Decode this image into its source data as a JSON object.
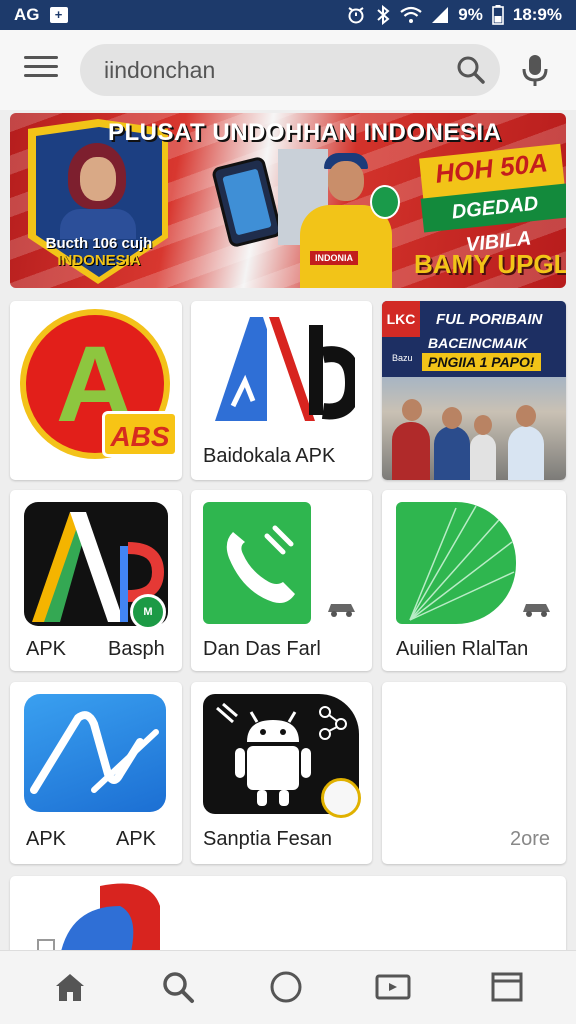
{
  "status_bar": {
    "carrier": "AG",
    "notification_glyph": "+",
    "battery_percent": "9%",
    "time": "18:9%"
  },
  "search": {
    "query": "iindonchan"
  },
  "banner": {
    "title": "PLUSAT UNDOHHAN INDONESIA",
    "shield_line1": "Bucth 106 cujh",
    "shield_line2": "INDONESIA",
    "promo_line1": "HOH 50A",
    "promo_line2": "DGEDAD VIBILA",
    "footer": "BAMY UPGL",
    "badge_text": "INDONIA"
  },
  "apps": [
    {
      "label": "",
      "logo_text": "A",
      "tag": "ABS"
    },
    {
      "label": "Baidokala APK",
      "logo_text": "Ab"
    },
    {
      "label": "",
      "photo_corner": "LKC",
      "photo_line1": "FUL PORIBAIN",
      "photo_line2": "BACEINCMAIK",
      "photo_line3": "PNGIIA 1 PAPO!",
      "photo_small": "Bazu"
    },
    {
      "label_left": "APK",
      "label_right": "Basph",
      "badge": "M"
    },
    {
      "label": "Dan Das Farl"
    },
    {
      "label": "Auilien RlalTan"
    },
    {
      "label_left": "APK",
      "label_right": "APK"
    },
    {
      "label": "Sanptia Fesan"
    },
    {
      "label": "",
      "meta": "2ore"
    }
  ],
  "nav": {
    "items": [
      "home",
      "search",
      "circle",
      "video",
      "browser"
    ]
  },
  "colors": {
    "status_bar": "#1d3a6b",
    "accent_green": "#2fb64f",
    "accent_red": "#e21f1a",
    "accent_yellow": "#f3c21a"
  }
}
